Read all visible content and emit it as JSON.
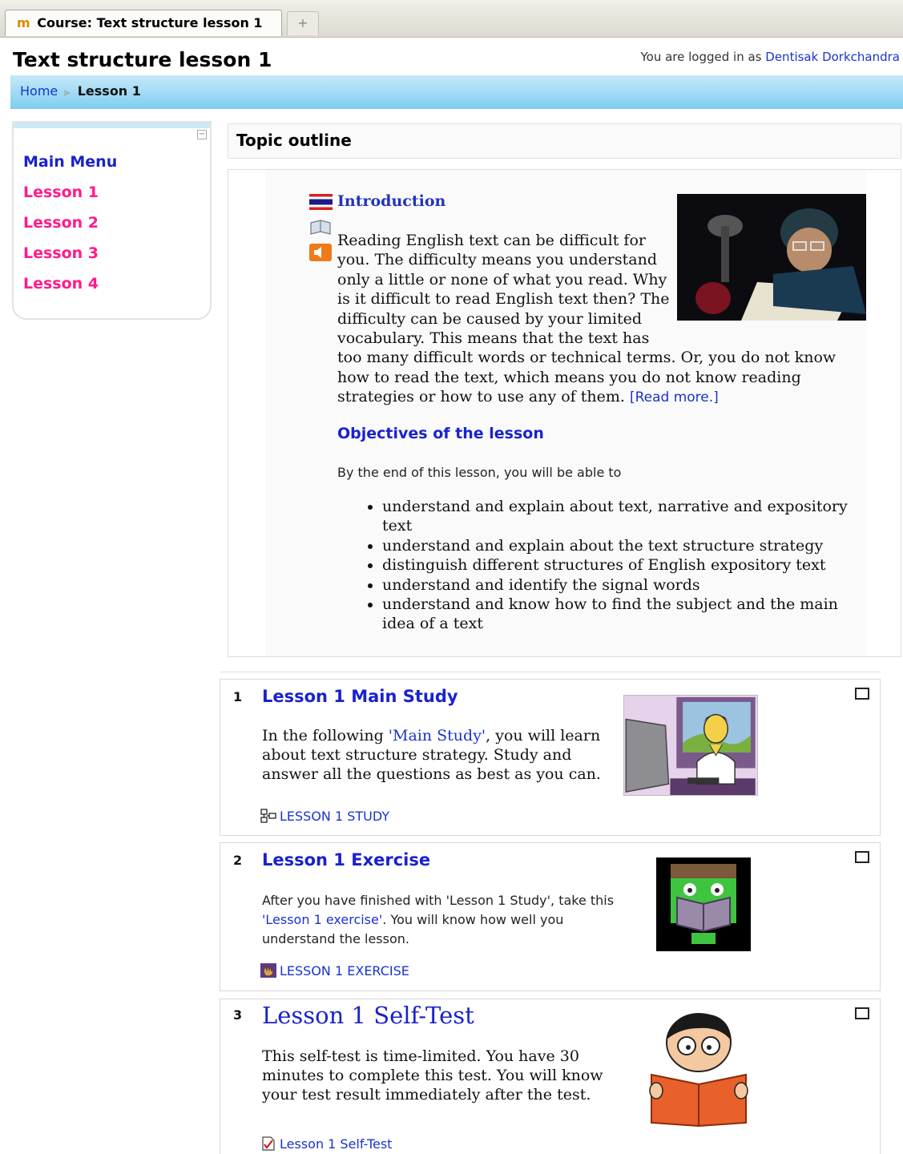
{
  "browser": {
    "tab_title": "Course: Text structure lesson 1",
    "new_tab_glyph": "+"
  },
  "header": {
    "page_title": "Text structure lesson 1",
    "login_prefix": "You are logged in as",
    "user_name": "Dentisak Dorkchandra"
  },
  "breadcrumb": {
    "home": "Home",
    "separator": "▶",
    "current": "Lesson 1"
  },
  "sidebar": {
    "collapse_glyph": "−",
    "items": [
      {
        "label": "Main Menu"
      },
      {
        "label": "Lesson 1"
      },
      {
        "label": "Lesson 2"
      },
      {
        "label": "Lesson 3"
      },
      {
        "label": "Lesson 4"
      }
    ]
  },
  "topic": {
    "header": "Topic outline",
    "intro_title": "Introduction",
    "intro_text": "Reading English text can be difficult for you. The difficulty means you understand only a little or none of what you read. Why is it difficult to read English text then? The difficulty can be caused by your limited vocabulary. This means that the text has too many difficult words or technical terms. Or, you do not know how to read the text, which means you do not know reading strategies or how to use any of them.",
    "read_more": "[Read more.]",
    "objectives_title": "Objectives of the lesson",
    "objectives_intro": "By the end of this lesson, you will be able to",
    "objectives": [
      "understand and explain about text, narrative and expository text",
      "understand and explain about the text structure strategy",
      "distinguish different structures of English expository text",
      "understand and identify the signal words",
      "understand and know how to find the subject and the main idea of a text"
    ]
  },
  "sections": [
    {
      "number": "1",
      "title": "Lesson 1 Main Study",
      "text_before": "In the following ",
      "link": "'Main Study'",
      "text_after": ", you will learn about text structure strategy. Study and answer all the questions as best as you can.",
      "resource": "LESSON 1 STUDY",
      "resource_icon": "lesson-structure-icon"
    },
    {
      "number": "2",
      "title": "Lesson 1 Exercise",
      "text_before": "After you have finished with 'Lesson 1 Study', take this ",
      "link": "'Lesson 1 exercise'",
      "text_after": ". You will know how well you understand the lesson.",
      "resource": "LESSON 1 EXERCISE",
      "resource_icon": "hand-icon"
    },
    {
      "number": "3",
      "title": "Lesson 1 Self-Test",
      "text_before": "This ",
      "link": "self-test",
      "text_after": " is time-limited. You have 30 minutes to complete this test. You will know your test result immediately after the test.",
      "resource": "Lesson 1 Self-Test",
      "resource_icon": "quiz-check-icon"
    }
  ],
  "colors": {
    "link": "#1a33cc",
    "lesson_menu": "#ff1a8c",
    "main_menu": "#1a22cc",
    "navbar": "#7fcdf0"
  }
}
